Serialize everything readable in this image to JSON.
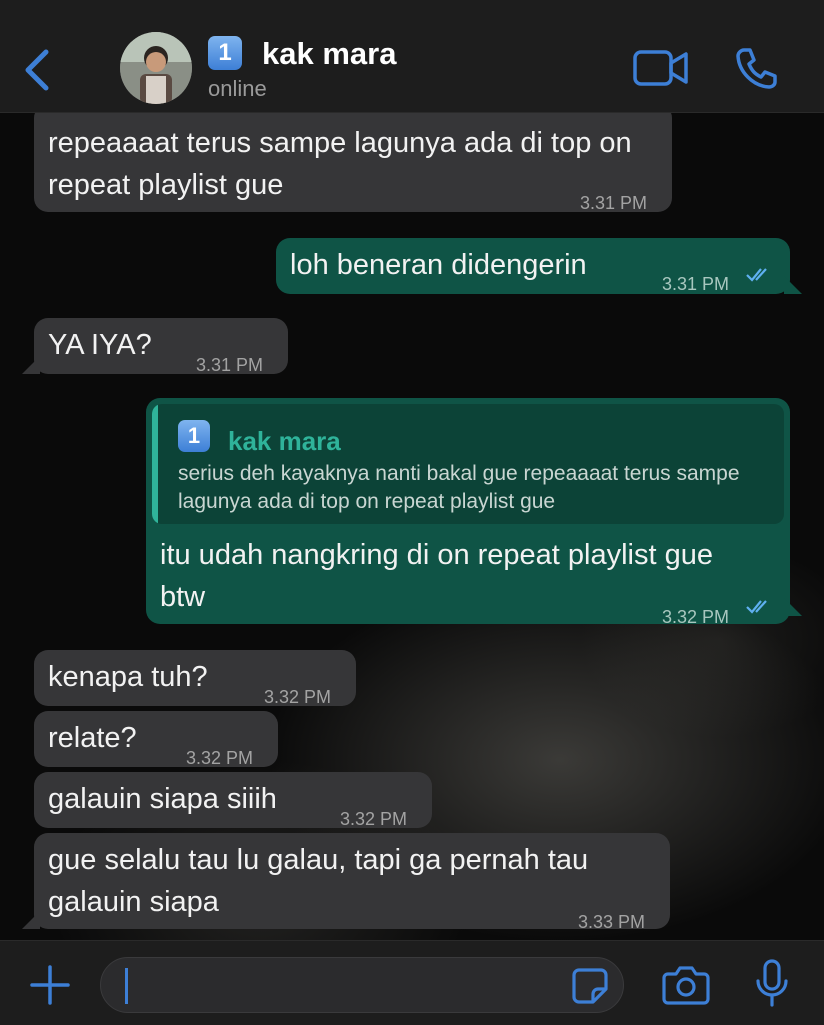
{
  "header": {
    "contact_name": "kak mara",
    "badge": "1",
    "status": "online"
  },
  "messages": [
    {
      "direction": "in",
      "text": "repeaaaat terus sampe lagunya ada di top on repeat playlist gue",
      "time": "3.31 PM"
    },
    {
      "direction": "out",
      "text": "loh beneran didengerin",
      "time": "3.31 PM",
      "read": true
    },
    {
      "direction": "in",
      "text": "YA IYA?",
      "time": "3.31 PM"
    },
    {
      "direction": "out",
      "quote_name": "kak mara",
      "quote_text": "serius deh kayaknya nanti bakal gue repeaaaat terus sampe lagunya ada di top on repeat playlist gue",
      "text": "itu udah nangkring di on repeat playlist gue btw",
      "time": "3.32 PM",
      "read": true
    },
    {
      "direction": "in",
      "text": "kenapa tuh?",
      "time": "3.32 PM"
    },
    {
      "direction": "in",
      "text": "relate?",
      "time": "3.32 PM"
    },
    {
      "direction": "in",
      "text": "galauin siapa siiih",
      "time": "3.32 PM"
    },
    {
      "direction": "in",
      "text": "gue selalu tau lu galau, tapi ga pernah tau galauin siapa",
      "time": "3.33 PM"
    }
  ],
  "colors": {
    "accent": "#3d7fd6",
    "incoming_bubble": "#363638",
    "outgoing_bubble": "#0f5446",
    "quote_accent": "#2fb39a"
  },
  "icons": [
    "back-chevron-icon",
    "video-call-icon",
    "phone-icon",
    "plus-icon",
    "sticker-icon",
    "camera-icon",
    "microphone-icon",
    "double-check-icon"
  ]
}
